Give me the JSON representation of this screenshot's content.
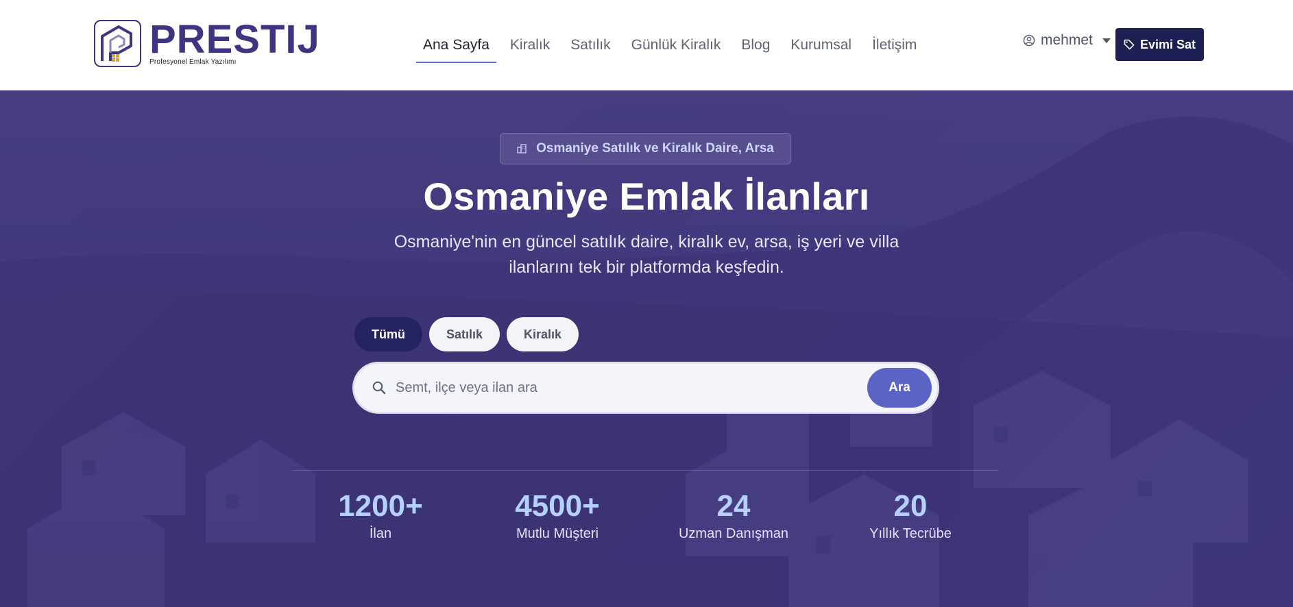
{
  "brand": {
    "name": "PRESTIJ",
    "tagline": "Profesyonel Emlak Yazılımı",
    "colors": {
      "primary": "#3d3581",
      "accent": "#e6a11f",
      "dark_button": "#1e1f52"
    }
  },
  "nav": {
    "items": [
      {
        "label": "Ana Sayfa",
        "active": true
      },
      {
        "label": "Kiralık",
        "active": false
      },
      {
        "label": "Satılık",
        "active": false
      },
      {
        "label": "Günlük Kiralık",
        "active": false
      },
      {
        "label": "Blog",
        "active": false
      },
      {
        "label": "Kurumsal",
        "active": false
      },
      {
        "label": "İletişim",
        "active": false
      }
    ]
  },
  "user": {
    "name": "mehmet",
    "icon": "user-circle-icon"
  },
  "cta": {
    "label": "Evimi Sat",
    "icon": "tag-icon"
  },
  "hero": {
    "badge": "Osmaniye Satılık ve Kiralık Daire, Arsa",
    "badge_icon": "building-icon",
    "title": "Osmaniye Emlak İlanları",
    "subtitle_line1": "Osmaniye'nin en güncel satılık daire, kiralık ev, arsa, iş yeri ve villa",
    "subtitle_line2": "ilanlarını tek bir platformda keşfedin."
  },
  "filters": {
    "options": [
      {
        "label": "Tümü",
        "active": true
      },
      {
        "label": "Satılık",
        "active": false
      },
      {
        "label": "Kiralık",
        "active": false
      }
    ]
  },
  "search": {
    "placeholder": "Semt, ilçe veya ilan ara",
    "value": "",
    "button_label": "Ara"
  },
  "stats": [
    {
      "value": "1200+",
      "label": "İlan"
    },
    {
      "value": "4500+",
      "label": "Mutlu Müşteri"
    },
    {
      "value": "24",
      "label": "Uzman Danışman"
    },
    {
      "value": "20",
      "label": "Yıllık Tecrübe"
    }
  ]
}
